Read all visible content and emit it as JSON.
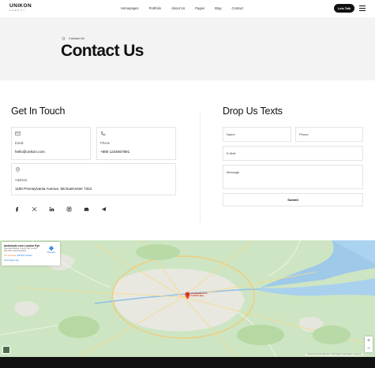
{
  "header": {
    "logo": "UNIKON",
    "logo_sub": "AGENCY",
    "nav": [
      "Homepages",
      "Portfolio",
      "About Us",
      "Pages",
      "Blog",
      "Contact"
    ],
    "cta": "Lets Talk",
    "menu_icon": "hamburger-icon"
  },
  "banner": {
    "breadcrumb": "Contact Us",
    "title": "Contact Us"
  },
  "touch": {
    "title": "Get In Touch",
    "email": {
      "label": "Email",
      "value": "hello@unikon.com",
      "icon": "mail-icon"
    },
    "phone": {
      "label": "Phone",
      "value": "+880 1234567891",
      "icon": "phone-icon"
    },
    "address": {
      "label": "Address",
      "value": "1180 Pennsylvania Avenue, Michaelcester 7322",
      "icon": "map-pin-icon"
    },
    "socials": [
      "facebook-icon",
      "x-icon",
      "linkedin-icon",
      "instagram-icon",
      "discord-icon",
      "telegram-icon"
    ]
  },
  "form": {
    "title": "Drop Us Texts",
    "name_placeholder": "Name",
    "phone_placeholder": "Phone",
    "email_placeholder": "E-Mail",
    "message_placeholder": "Message",
    "submit": "Submit"
  },
  "map": {
    "place_name": "lastminute.com London Eye",
    "address": "Riverside Building, County Hall, London SE1 7PB, United Kingdom",
    "rating": "4.5 ★★★★★",
    "reviews": "250,501 reviews",
    "larger_map": "View larger map",
    "directions": "Directions",
    "pin_label": "lastminute.com London Eye",
    "attribution": "Keyboard shortcuts   Map data ©2024 Google   Terms   Report a map error",
    "zoom_in": "+",
    "zoom_out": "−"
  }
}
